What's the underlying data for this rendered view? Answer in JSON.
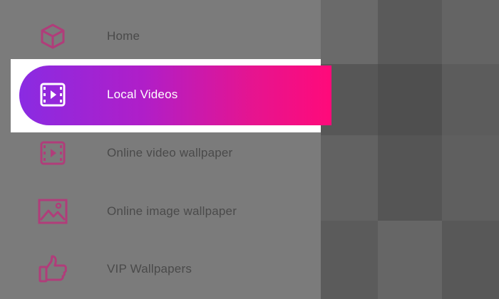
{
  "colors": {
    "icon_pink": "#b03d7a",
    "active_gradient_start": "#8a2be2",
    "active_gradient_end": "#ff0a7a",
    "label_inactive": "#4a4a4a",
    "label_active": "#ffffff"
  },
  "menu": {
    "items": [
      {
        "label": "Home",
        "icon": "cube-icon",
        "active": false
      },
      {
        "label": "Local Videos",
        "icon": "film-play-icon",
        "active": true
      },
      {
        "label": "Online video wallpaper",
        "icon": "film-play-icon",
        "active": false
      },
      {
        "label": "Online image wallpaper",
        "icon": "image-icon",
        "active": false
      },
      {
        "label": "VIP Wallpapers",
        "icon": "thumbs-up-icon",
        "active": false
      }
    ]
  }
}
